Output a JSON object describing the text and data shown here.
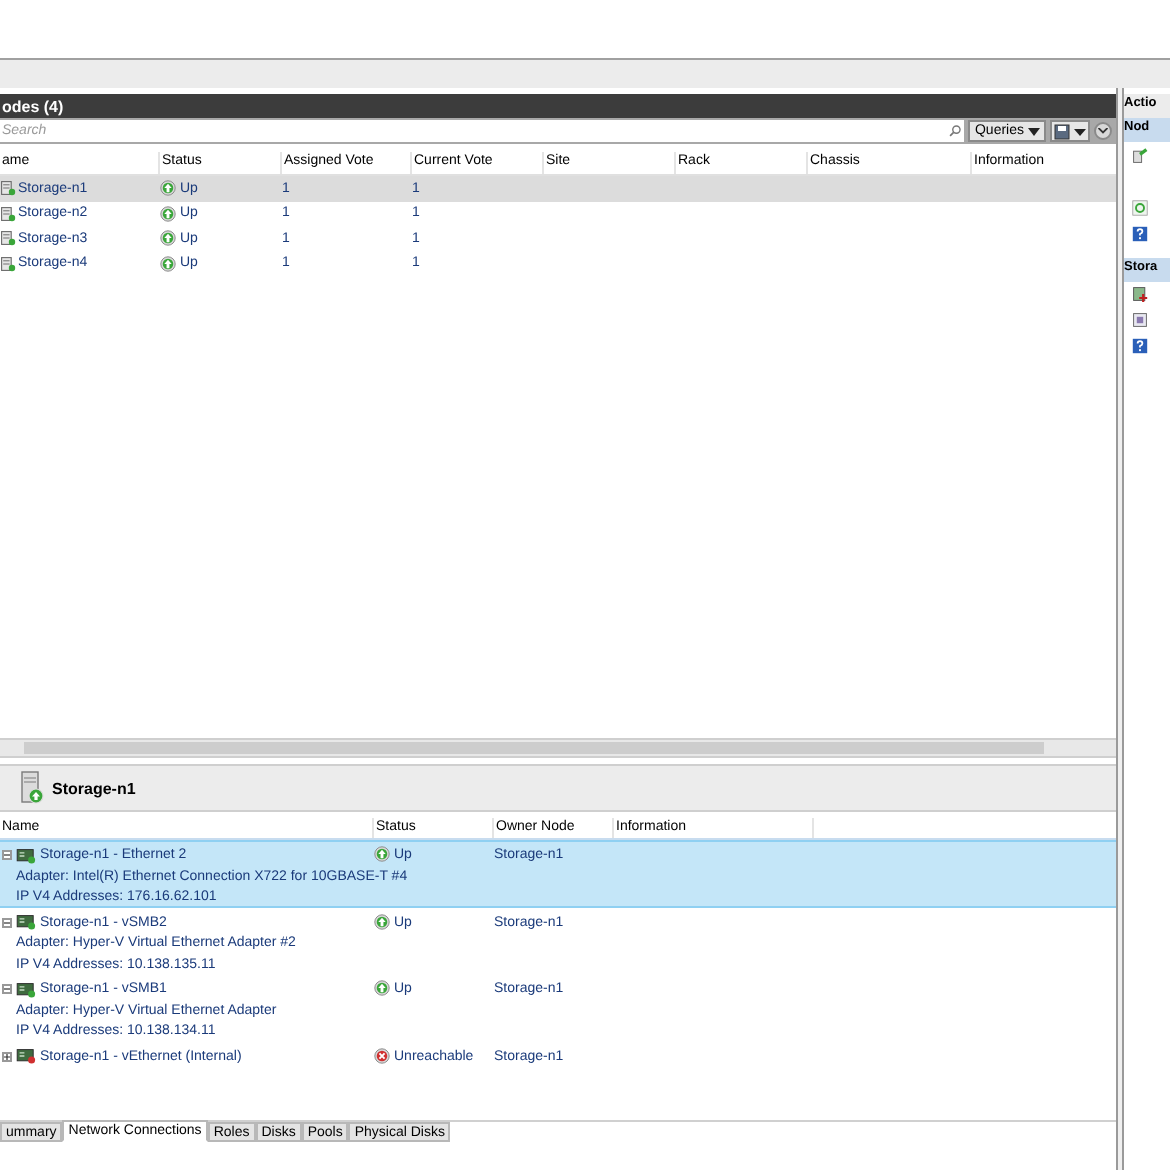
{
  "nodes_pane": {
    "title": "odes (4)",
    "search": {
      "placeholder": "Search"
    },
    "queries_button": "Queries",
    "columns": [
      "ame",
      "Status",
      "Assigned Vote",
      "Current Vote",
      "Site",
      "Rack",
      "Chassis",
      "Information"
    ],
    "rows": [
      {
        "name": "Storage-n1",
        "status": "Up",
        "assigned_vote": "1",
        "current_vote": "1",
        "selected": true
      },
      {
        "name": "Storage-n2",
        "status": "Up",
        "assigned_vote": "1",
        "current_vote": "1",
        "selected": false
      },
      {
        "name": "Storage-n3",
        "status": "Up",
        "assigned_vote": "1",
        "current_vote": "1",
        "selected": false
      },
      {
        "name": "Storage-n4",
        "status": "Up",
        "assigned_vote": "1",
        "current_vote": "1",
        "selected": false
      }
    ]
  },
  "detail_pane": {
    "title": "Storage-n1",
    "columns": [
      "Name",
      "Status",
      "Owner Node",
      "Information"
    ],
    "rows": [
      {
        "name": "Storage-n1 - Ethernet 2",
        "adapter": "Adapter: Intel(R) Ethernet Connection X722 for 10GBASE-T #4",
        "ip": "IP V4 Addresses: 176.16.62.101",
        "status": "Up",
        "kind": "up",
        "owner": "Storage-n1",
        "expanded": true,
        "selected": true
      },
      {
        "name": "Storage-n1 - vSMB2",
        "adapter": "Adapter: Hyper-V Virtual Ethernet Adapter #2",
        "ip": "IP V4 Addresses: 10.138.135.11",
        "status": "Up",
        "kind": "up",
        "owner": "Storage-n1",
        "expanded": true,
        "selected": false
      },
      {
        "name": "Storage-n1 - vSMB1",
        "adapter": "Adapter: Hyper-V Virtual Ethernet Adapter",
        "ip": "IP V4 Addresses: 10.138.134.11",
        "status": "Up",
        "kind": "up",
        "owner": "Storage-n1",
        "expanded": true,
        "selected": false
      },
      {
        "name": "Storage-n1 - vEthernet (Internal)",
        "status": "Unreachable",
        "kind": "down",
        "owner": "Storage-n1",
        "expanded": false,
        "selected": false
      }
    ],
    "tabs": [
      {
        "label": "ummary",
        "selected": false
      },
      {
        "label": "Network Connections",
        "selected": true
      },
      {
        "label": "Roles",
        "selected": false
      },
      {
        "label": "Disks",
        "selected": false
      },
      {
        "label": "Pools",
        "selected": false
      },
      {
        "label": "Physical Disks",
        "selected": false
      }
    ]
  },
  "actions_pane": {
    "title": "Actio",
    "sections": [
      {
        "title": "Nod"
      },
      {
        "title": "Stora"
      }
    ]
  }
}
